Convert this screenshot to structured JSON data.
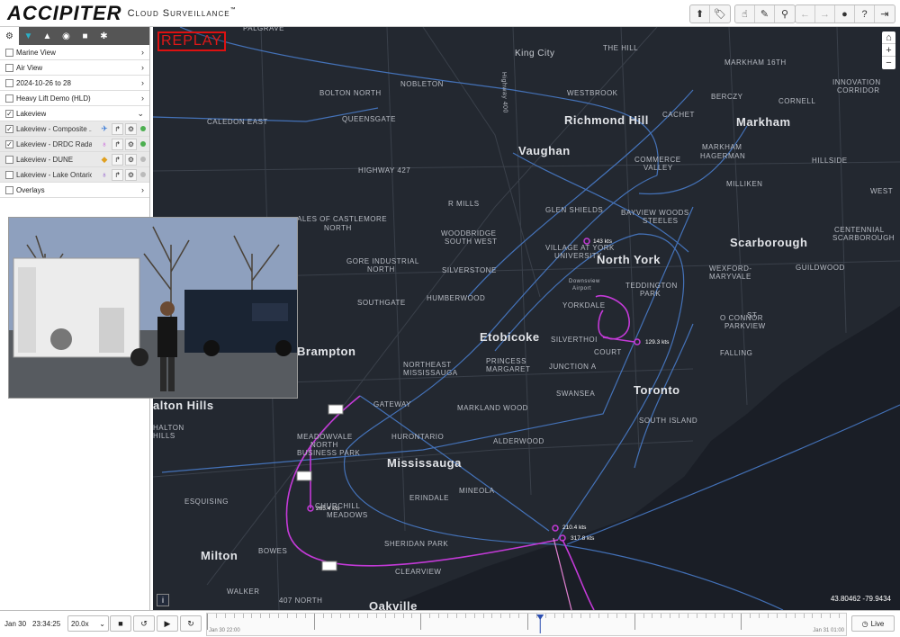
{
  "header": {
    "brand": "ACCIPITER",
    "tagline": "Cloud Surveillance",
    "tm": "™",
    "toolbar_groups": [
      [
        "arrow-up-icon",
        "tag-icon"
      ],
      [
        "hand-pointer-icon",
        "ruler-icon",
        "map-pin-icon"
      ],
      [
        "arrow-left-icon",
        "arrow-right-icon",
        "circle-icon",
        "help-icon",
        "logout-icon"
      ]
    ]
  },
  "sidebar": {
    "tabs": [
      "settings-icon",
      "filter-icon",
      "alert-icon",
      "eye-icon",
      "camera-icon",
      "gear-icon"
    ],
    "items": [
      {
        "label": "Marine View",
        "checked": false,
        "expanded": false
      },
      {
        "label": "Air View",
        "checked": false,
        "expanded": false
      },
      {
        "label": "2024-10-26 to 28",
        "checked": false,
        "expanded": false
      },
      {
        "label": "Heavy Lift Demo (HLD)",
        "checked": false,
        "expanded": false
      },
      {
        "label": "Lakeview",
        "checked": true,
        "expanded": true
      }
    ],
    "subitems": [
      {
        "label": "Lakeview - Composite ...",
        "checked": true,
        "icon": "plane-icon",
        "icon_color": "#3b7bd6",
        "status": "#4caf50"
      },
      {
        "label": "Lakeview - DRDC Radar",
        "checked": true,
        "icon": "radar-icon",
        "icon_color": "#c040d8",
        "status": "#4caf50"
      },
      {
        "label": "Lakeview - DUNE",
        "checked": false,
        "icon": "diamond-icon",
        "icon_color": "#e0a020",
        "status": "#bbbbbb"
      },
      {
        "label": "Lakeview - Lake Ontario...",
        "checked": false,
        "icon": "radar-icon",
        "icon_color": "#8040c8",
        "status": "#bbbbbb"
      }
    ],
    "overlays": {
      "label": "Overlays",
      "checked": false
    }
  },
  "map": {
    "replay_label": "REPLAY",
    "coords": "43.80462 -79.9434",
    "cities": [
      {
        "name": "Richmond Hill"
      },
      {
        "name": "Markham"
      },
      {
        "name": "Vaughan"
      },
      {
        "name": "North York"
      },
      {
        "name": "Scarborough"
      },
      {
        "name": "Etobicoke"
      },
      {
        "name": "Toronto"
      },
      {
        "name": "Mississauga"
      },
      {
        "name": "Brampton"
      },
      {
        "name": "Milton"
      },
      {
        "name": "alton Hills"
      },
      {
        "name": "King City"
      },
      {
        "name": "Oakville"
      }
    ],
    "places": [
      "PALGRAVE",
      "NOBLETON",
      "THE HILL",
      "MARKHAM 16TH",
      "BOLTON NORTH",
      "WESTBROOK",
      "BERCZY",
      "CORNELL",
      "INNOVATION CORRIDOR",
      "CALEDON EAST",
      "QUEENSGATE",
      "CACHET",
      "MARKHAM HAGERMAN",
      "HIGHWAY 427",
      "COMMERCE VALLEY",
      "HILLSIDE",
      "MILLIKEN",
      "WEST",
      "R MILLS",
      "GLEN SHIELDS",
      "BAYVIEW WOODS STEELES",
      "ALES OF CASTLEMORE NORTH",
      "WOODBRIDGE SOUTH WEST",
      "VILLAGE AT YORK UNIVERSITY",
      "CENTENNIAL SCARBOROUGH",
      "GORE INDUSTRIAL NORTH",
      "SILVERSTONE",
      "GUILDWOOD",
      "WEXFORD-MARYVALE",
      "SOUTHGATE",
      "HUMBERWOOD",
      "Downsview Airport",
      "TEDDINGTON PARK",
      "YORKDALE",
      "O CONNOR PARKVIEW",
      "ST",
      "SILVERTHORN",
      "COURT",
      "FALLING",
      "NORTHEAST MISSISSAUGA",
      "PRINCESS MARGARET",
      "JUNCTION A",
      "SWANSEA",
      "GATEWAY",
      "MARKLAND WOOD",
      "SOUTH ISLAND",
      "HALTON HILLS",
      "HURONTARIO",
      "ALDERWOOD",
      "MEADOWVALE NORTH BUSINESS PARK",
      "ERINDALE",
      "MINEOLA",
      "ESQUISING",
      "CHURCHILL MEADOWS",
      "SHERIDAN PARK",
      "BOWES",
      "CLEARVIEW",
      "WALKER",
      "407 NORTH",
      "Highway 400"
    ],
    "targets": [
      {
        "label": "143 kts"
      },
      {
        "label": "129.3 kts"
      },
      {
        "label": "265.4 kts"
      },
      {
        "label": "210.4 kts"
      },
      {
        "label": "317.8 kts"
      }
    ]
  },
  "bottombar": {
    "date": "Jan 30",
    "time": "23:34:25",
    "speed": "20.0x",
    "timeline_start": "Jan 30 22:00",
    "timeline_end": "Jan 31 01:00",
    "playhead_fraction": 0.52,
    "live_label": "Live"
  }
}
